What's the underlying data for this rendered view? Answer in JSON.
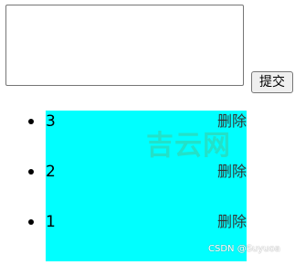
{
  "form": {
    "textarea_value": "",
    "submit_label": "提交"
  },
  "list": {
    "items": [
      {
        "text": "3",
        "delete_label": "删除"
      },
      {
        "text": "2",
        "delete_label": "删除"
      },
      {
        "text": "1",
        "delete_label": "删除"
      }
    ],
    "background_color": "#00ffff"
  },
  "watermark": {
    "logo_text": "吉云网",
    "credit_text": "CSDN @Suyuoa"
  }
}
